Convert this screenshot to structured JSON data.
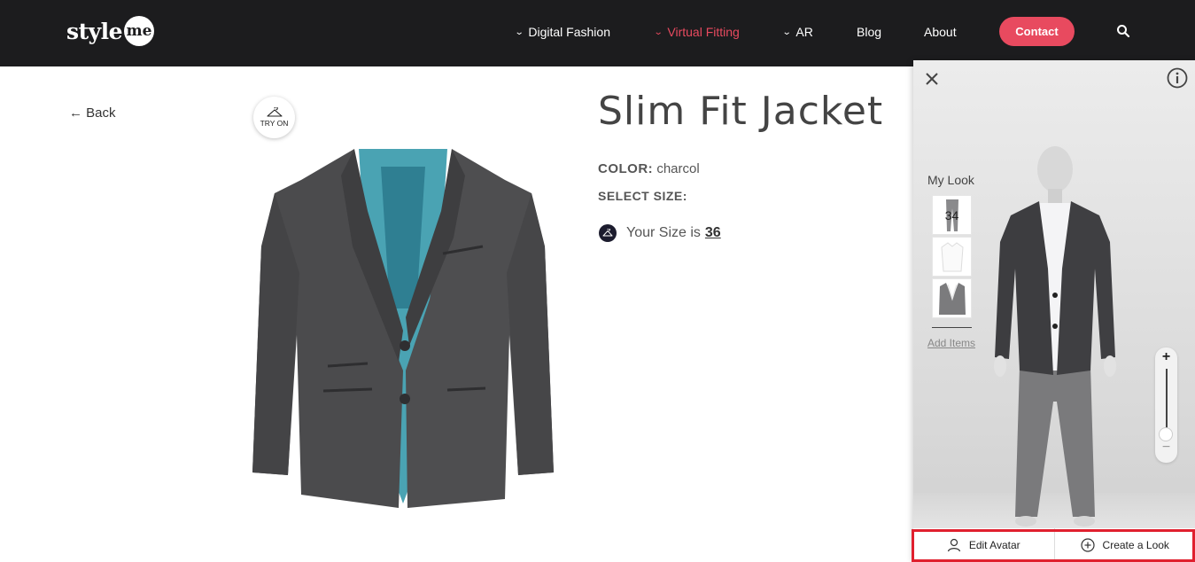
{
  "header": {
    "logo_text": "style",
    "logo_badge": "me",
    "nav": [
      {
        "label": "Digital Fashion",
        "has_chevron": true
      },
      {
        "label": "Virtual Fitting",
        "has_chevron": true,
        "active": true
      },
      {
        "label": "AR",
        "has_chevron": true
      },
      {
        "label": "Blog",
        "has_chevron": false
      },
      {
        "label": "About",
        "has_chevron": false
      }
    ],
    "contact_label": "Contact",
    "accent_color": "#e84a5f",
    "search_icon": "search-icon"
  },
  "main": {
    "back_label": "← Back",
    "try_on_label": "TRY ON",
    "product_title": "Slim Fit Jacket",
    "color_label": "COLOR:",
    "color_value": "charcol",
    "select_size_label": "SELECT SIZE:",
    "your_size_label": "Your Size is",
    "your_size_value": "36"
  },
  "panel": {
    "my_look_label": "My Look",
    "thumbnails": [
      {
        "label": "34",
        "item": "pants"
      },
      {
        "label": "",
        "item": "shirt"
      },
      {
        "label": "",
        "item": "jacket"
      }
    ],
    "add_items_label": "Add Items",
    "zoom_plus": "+",
    "zoom_minus": "−",
    "edit_avatar_label": "Edit Avatar",
    "create_look_label": "Create a Look",
    "highlight_color": "#e0202e"
  }
}
